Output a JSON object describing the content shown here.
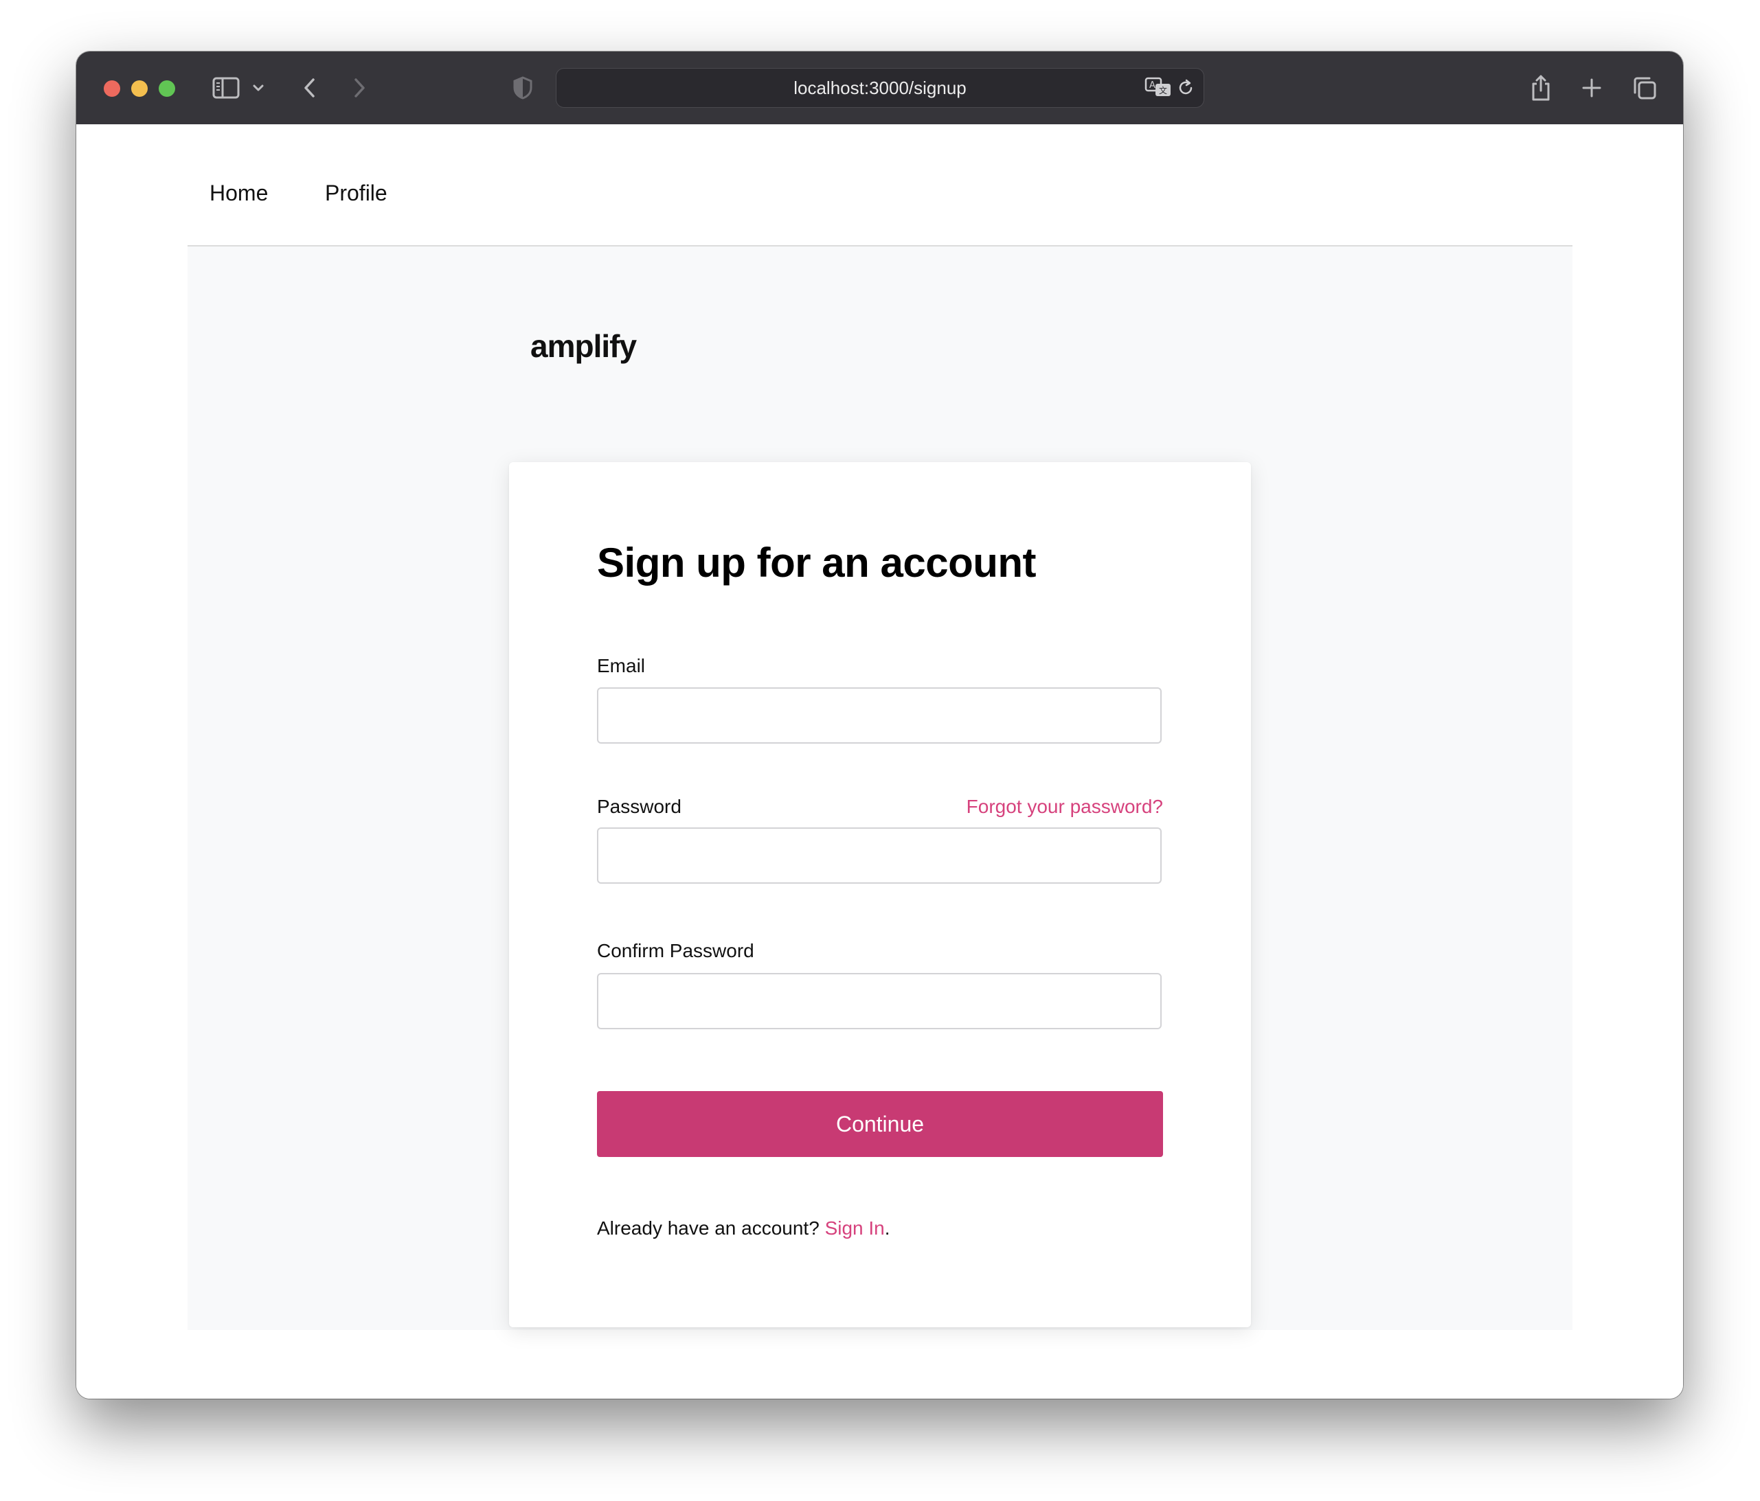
{
  "browser": {
    "url": "localhost:3000/signup",
    "icons": {
      "sidebar": "sidebar-icon",
      "chevron": "chevron-down-icon",
      "back": "back-arrow-icon",
      "forward": "forward-arrow-icon",
      "shield": "privacy-shield-icon",
      "translate": "translate-icon",
      "reload": "reload-icon",
      "share": "share-icon",
      "new_tab": "plus-icon",
      "tabs": "tab-overview-icon"
    }
  },
  "nav": {
    "items": [
      {
        "label": "Home"
      },
      {
        "label": "Profile"
      }
    ]
  },
  "brand": "amplify",
  "form": {
    "title": "Sign up for an account",
    "email_label": "Email",
    "email_value": "",
    "password_label": "Password",
    "password_value": "",
    "forgot_label": "Forgot your password?",
    "confirm_label": "Confirm Password",
    "confirm_value": "",
    "submit_label": "Continue",
    "footer_text": "Already have an account?",
    "signin_label": "Sign In",
    "footer_end": "."
  },
  "colors": {
    "accent": "#c83a73",
    "link": "#d6427d",
    "titlebar": "#36353a",
    "page_bg": "#f8f9fa"
  }
}
